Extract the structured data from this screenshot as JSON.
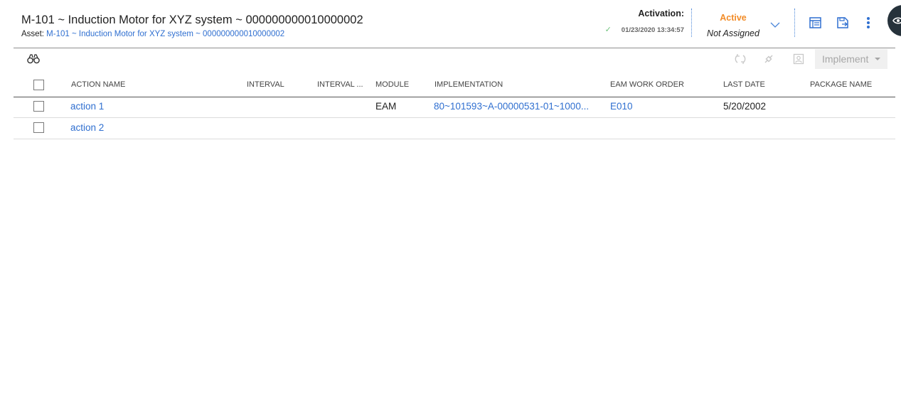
{
  "header": {
    "title": "M-101 ~ Induction Motor for XYZ system ~ 000000000010000002",
    "asset_label": "Asset:",
    "asset_link": "M-101 ~ Induction Motor for XYZ system ~ 000000000010000002",
    "activation_label": "Activation:",
    "activation_date": "01/23/2020 13:34:57",
    "status": "Active",
    "assignment": "Not Assigned"
  },
  "toolbar": {
    "implement_label": "Implement"
  },
  "table": {
    "columns": [
      "ACTION NAME",
      "INTERVAL",
      "INTERVAL ...",
      "MODULE",
      "IMPLEMENTATION",
      "EAM WORK ORDER",
      "LAST DATE",
      "PACKAGE NAME"
    ],
    "rows": [
      {
        "action_name": "action 1",
        "interval": "",
        "interval_units": "",
        "module": "EAM",
        "implementation": "80~101593~A-00000531-01~1000...",
        "eam_work_order": "E010",
        "last_date": "5/20/2002",
        "package_name": ""
      },
      {
        "action_name": "action 2",
        "interval": "",
        "interval_units": "",
        "module": "",
        "implementation": "",
        "eam_work_order": "",
        "last_date": "",
        "package_name": ""
      }
    ]
  },
  "colors": {
    "link": "#2f6fd0",
    "active": "#f28c28",
    "icon_blue": "#2f6fd0",
    "dark_button": "#26323b"
  },
  "icons": [
    "check-circle-icon",
    "chevron-down-icon",
    "table-view-icon",
    "save-icon",
    "more-vert-icon",
    "binoculars-icon",
    "refresh-icon",
    "link-icon",
    "image-icon",
    "caret-down-icon"
  ]
}
